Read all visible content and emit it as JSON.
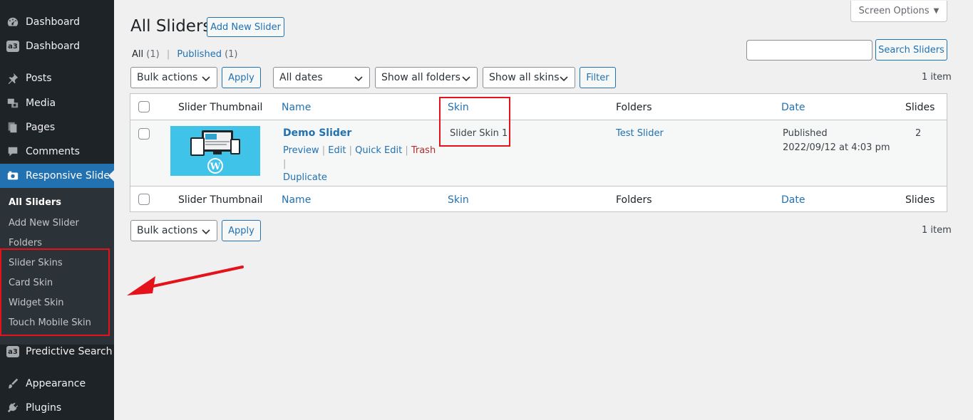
{
  "sidebar": {
    "items": [
      {
        "label": "Dashboard",
        "icon": "gauge-icon"
      },
      {
        "label": "Dashboard",
        "icon": "a3-icon"
      },
      {
        "label": "Posts",
        "icon": "pin-icon"
      },
      {
        "label": "Media",
        "icon": "media-icon"
      },
      {
        "label": "Pages",
        "icon": "pages-icon"
      },
      {
        "label": "Comments",
        "icon": "comment-icon"
      },
      {
        "label": "Responsive Slider",
        "icon": "camera-icon"
      },
      {
        "label": "Predictive Search",
        "icon": "a3-icon"
      },
      {
        "label": "Appearance",
        "icon": "brush-icon"
      },
      {
        "label": "Plugins",
        "icon": "plugin-icon"
      }
    ],
    "submenu": [
      "All Sliders",
      "Add New Slider",
      "Folders",
      "Slider Skins",
      "Card Skin",
      "Widget Skin",
      "Touch Mobile Skin"
    ],
    "a3_badge": "a3"
  },
  "header": {
    "title": "All Sliders",
    "add_new_label": "Add New Slider",
    "screen_options_label": "Screen Options"
  },
  "views": {
    "all_label": "All",
    "all_count": "(1)",
    "published_label": "Published",
    "published_count": "(1)",
    "separator": "|"
  },
  "search": {
    "value": "",
    "button_label": "Search Sliders"
  },
  "filters": {
    "bulk_actions": "Bulk actions",
    "apply_label": "Apply",
    "dates": "All dates",
    "folders": "Show all folders",
    "skins": "Show all skins",
    "filter_label": "Filter",
    "items_count": "1 item"
  },
  "table": {
    "columns": [
      "Slider Thumbnail",
      "Name",
      "Skin",
      "Folders",
      "Date",
      "Slides"
    ],
    "rows": [
      {
        "name": "Demo Slider",
        "actions": [
          "Preview",
          "Edit",
          "Quick Edit",
          "Trash",
          "Duplicate"
        ],
        "skin": "Slider Skin 1",
        "folder": "Test Slider",
        "status": "Published",
        "date": "2022/09/12 at 4:03 pm",
        "slides": "2"
      }
    ]
  },
  "colors": {
    "sidebar_bg": "#1d2327",
    "active_menu": "#2271b1",
    "link": "#2271b1",
    "highlight": "#e5121b",
    "trash": "#b32d2e"
  }
}
